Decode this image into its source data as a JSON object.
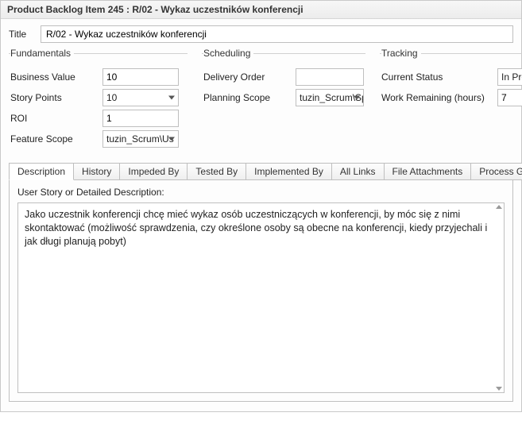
{
  "window_title": "Product Backlog Item 245 : R/02 - Wykaz uczestników konferencji",
  "title_label": "Title",
  "title_value": "R/02 - Wykaz uczestników konferencji",
  "groups": {
    "fundamentals": {
      "legend": "Fundamentals",
      "business_value_label": "Business Value",
      "business_value": "10",
      "story_points_label": "Story Points",
      "story_points": "10",
      "roi_label": "ROI",
      "roi": "1",
      "feature_scope_label": "Feature Scope",
      "feature_scope": "tuzin_Scrum\\Us"
    },
    "scheduling": {
      "legend": "Scheduling",
      "delivery_order_label": "Delivery Order",
      "delivery_order": "",
      "planning_scope_label": "Planning Scope",
      "planning_scope": "tuzin_Scrum\\Sp"
    },
    "tracking": {
      "legend": "Tracking",
      "current_status_label": "Current Status",
      "current_status": "In Pro",
      "work_remaining_label": "Work Remaining (hours)",
      "work_remaining": "7"
    }
  },
  "tabs": {
    "description": "Description",
    "history": "History",
    "impeded_by": "Impeded By",
    "tested_by": "Tested By",
    "implemented_by": "Implemented By",
    "all_links": "All Links",
    "file_attachments": "File Attachments",
    "process_guidance": "Process Guidance"
  },
  "description": {
    "label": "User Story or Detailed Description:",
    "text": "Jako uczestnik konferencji chcę mieć wykaz osób uczestniczących w konferencji,  by móc się z nimi skontaktować (możliwość sprawdzenia, czy określone osoby są obecne na konferencji, kiedy przyjechali i jak długi planują pobyt)"
  }
}
